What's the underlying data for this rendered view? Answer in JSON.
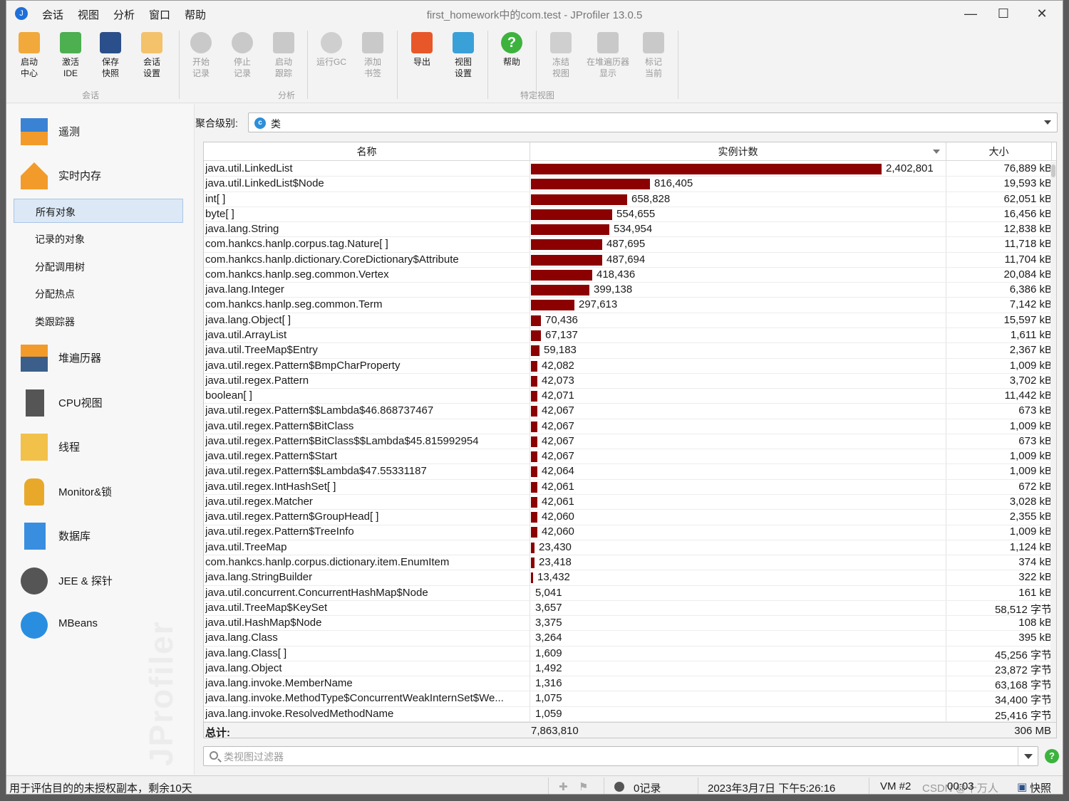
{
  "menu": {
    "items": [
      "会话",
      "视图",
      "分析",
      "窗口",
      "帮助"
    ]
  },
  "window": {
    "title": "first_homework中的com.test - JProfiler 13.0.5",
    "minimize": "—",
    "maximize": "☐",
    "close": "✕"
  },
  "toolbar": {
    "buttons": [
      {
        "label": "启动\n中心",
        "icon": "start-center-icon",
        "enabled": true
      },
      {
        "label": "激活\nIDE",
        "icon": "activate-ide-icon",
        "enabled": true
      },
      {
        "label": "保存\n快照",
        "icon": "save-snapshot-icon",
        "enabled": true
      },
      {
        "label": "会话\n设置",
        "icon": "session-settings-icon",
        "enabled": true
      },
      {
        "label": "开始\n记录",
        "icon": "start-recording-icon",
        "enabled": false
      },
      {
        "label": "停止\n记录",
        "icon": "stop-recording-icon",
        "enabled": false
      },
      {
        "label": "启动\n跟踪",
        "icon": "start-tracking-icon",
        "enabled": false
      },
      {
        "label": "运行GC",
        "icon": "run-gc-icon",
        "enabled": false
      },
      {
        "label": "添加\n书签",
        "icon": "add-bookmark-icon",
        "enabled": false
      },
      {
        "label": "导出",
        "icon": "export-icon",
        "enabled": true
      },
      {
        "label": "视图\n设置",
        "icon": "view-settings-icon",
        "enabled": true
      },
      {
        "label": "帮助",
        "icon": "help-icon",
        "enabled": true
      },
      {
        "label": "冻结\n视图",
        "icon": "freeze-view-icon",
        "enabled": false
      },
      {
        "label": "在堆遍历器\n显示",
        "icon": "show-in-heap-walker-icon",
        "enabled": false
      },
      {
        "label": "标记\n当前",
        "icon": "mark-current-icon",
        "enabled": false
      }
    ],
    "groups": [
      "会话",
      "分析",
      "特定视图"
    ]
  },
  "sidebar": {
    "sections": [
      {
        "label": "遥测",
        "icon": "telemetry-icon"
      },
      {
        "label": "实时内存",
        "icon": "live-memory-icon"
      },
      {
        "label": "堆遍历器",
        "icon": "heap-walker-icon"
      },
      {
        "label": "CPU视图",
        "icon": "cpu-views-icon"
      },
      {
        "label": "线程",
        "icon": "threads-icon"
      },
      {
        "label": "Monitor&锁",
        "icon": "monitors-locks-icon"
      },
      {
        "label": "数据库",
        "icon": "databases-icon"
      },
      {
        "label": "JEE & 探针",
        "icon": "jee-probes-icon"
      },
      {
        "label": "MBeans",
        "icon": "mbeans-icon"
      }
    ],
    "live_memory_items": [
      "所有对象",
      "记录的对象",
      "分配调用树",
      "分配热点",
      "类跟踪器"
    ],
    "selected": "所有对象",
    "watermark": "JProfiler"
  },
  "main": {
    "aggregation_label": "聚合级别:",
    "aggregation_value": "类",
    "aggregation_icon_letter": "c",
    "columns": [
      "名称",
      "实例计数",
      "大小"
    ],
    "total_label": "总计:",
    "total_count": "7,863,810",
    "total_size": "306 MB",
    "filter_placeholder": "类视图过滤器",
    "bar_color": "#8b0000"
  },
  "rows": [
    {
      "name": "java.util.LinkedList",
      "count": 2402801,
      "count_label": "2,402,801",
      "size": "76,889 kB"
    },
    {
      "name": "java.util.LinkedList$Node",
      "count": 816405,
      "count_label": "816,405",
      "size": "19,593 kB"
    },
    {
      "name": "int[ ]",
      "count": 658828,
      "count_label": "658,828",
      "size": "62,051 kB"
    },
    {
      "name": "byte[ ]",
      "count": 554655,
      "count_label": "554,655",
      "size": "16,456 kB"
    },
    {
      "name": "java.lang.String",
      "count": 534954,
      "count_label": "534,954",
      "size": "12,838 kB"
    },
    {
      "name": "com.hankcs.hanlp.corpus.tag.Nature[ ]",
      "count": 487695,
      "count_label": "487,695",
      "size": "11,718 kB"
    },
    {
      "name": "com.hankcs.hanlp.dictionary.CoreDictionary$Attribute",
      "count": 487694,
      "count_label": "487,694",
      "size": "11,704 kB"
    },
    {
      "name": "com.hankcs.hanlp.seg.common.Vertex",
      "count": 418436,
      "count_label": "418,436",
      "size": "20,084 kB"
    },
    {
      "name": "java.lang.Integer",
      "count": 399138,
      "count_label": "399,138",
      "size": "6,386 kB"
    },
    {
      "name": "com.hankcs.hanlp.seg.common.Term",
      "count": 297613,
      "count_label": "297,613",
      "size": "7,142 kB"
    },
    {
      "name": "java.lang.Object[ ]",
      "count": 70436,
      "count_label": "70,436",
      "size": "15,597 kB"
    },
    {
      "name": "java.util.ArrayList",
      "count": 67137,
      "count_label": "67,137",
      "size": "1,611 kB"
    },
    {
      "name": "java.util.TreeMap$Entry",
      "count": 59183,
      "count_label": "59,183",
      "size": "2,367 kB"
    },
    {
      "name": "java.util.regex.Pattern$BmpCharProperty",
      "count": 42082,
      "count_label": "42,082",
      "size": "1,009 kB"
    },
    {
      "name": "java.util.regex.Pattern",
      "count": 42073,
      "count_label": "42,073",
      "size": "3,702 kB"
    },
    {
      "name": "boolean[ ]",
      "count": 42071,
      "count_label": "42,071",
      "size": "11,442 kB"
    },
    {
      "name": "java.util.regex.Pattern$$Lambda$46.868737467",
      "count": 42067,
      "count_label": "42,067",
      "size": "673 kB"
    },
    {
      "name": "java.util.regex.Pattern$BitClass",
      "count": 42067,
      "count_label": "42,067",
      "size": "1,009 kB"
    },
    {
      "name": "java.util.regex.Pattern$BitClass$$Lambda$45.815992954",
      "count": 42067,
      "count_label": "42,067",
      "size": "673 kB"
    },
    {
      "name": "java.util.regex.Pattern$Start",
      "count": 42067,
      "count_label": "42,067",
      "size": "1,009 kB"
    },
    {
      "name": "java.util.regex.Pattern$$Lambda$47.55331187",
      "count": 42064,
      "count_label": "42,064",
      "size": "1,009 kB"
    },
    {
      "name": "java.util.regex.IntHashSet[ ]",
      "count": 42061,
      "count_label": "42,061",
      "size": "672 kB"
    },
    {
      "name": "java.util.regex.Matcher",
      "count": 42061,
      "count_label": "42,061",
      "size": "3,028 kB"
    },
    {
      "name": "java.util.regex.Pattern$GroupHead[ ]",
      "count": 42060,
      "count_label": "42,060",
      "size": "2,355 kB"
    },
    {
      "name": "java.util.regex.Pattern$TreeInfo",
      "count": 42060,
      "count_label": "42,060",
      "size": "1,009 kB"
    },
    {
      "name": "java.util.TreeMap",
      "count": 23430,
      "count_label": "23,430",
      "size": "1,124 kB"
    },
    {
      "name": "com.hankcs.hanlp.corpus.dictionary.item.EnumItem",
      "count": 23418,
      "count_label": "23,418",
      "size": "374 kB"
    },
    {
      "name": "java.lang.StringBuilder",
      "count": 13432,
      "count_label": "13,432",
      "size": "322 kB"
    },
    {
      "name": "java.util.concurrent.ConcurrentHashMap$Node",
      "count": 5041,
      "count_label": "5,041",
      "size": "161 kB"
    },
    {
      "name": "java.util.TreeMap$KeySet",
      "count": 3657,
      "count_label": "3,657",
      "size": "58,512 字节"
    },
    {
      "name": "java.util.HashMap$Node",
      "count": 3375,
      "count_label": "3,375",
      "size": "108 kB"
    },
    {
      "name": "java.lang.Class",
      "count": 3264,
      "count_label": "3,264",
      "size": "395 kB"
    },
    {
      "name": "java.lang.Class[ ]",
      "count": 1609,
      "count_label": "1,609",
      "size": "45,256 字节"
    },
    {
      "name": "java.lang.Object",
      "count": 1492,
      "count_label": "1,492",
      "size": "23,872 字节"
    },
    {
      "name": "java.lang.invoke.MemberName",
      "count": 1316,
      "count_label": "1,316",
      "size": "63,168 字节"
    },
    {
      "name": "java.lang.invoke.MethodType$ConcurrentWeakInternSet$We...",
      "count": 1075,
      "count_label": "1,075",
      "size": "34,400 字节"
    },
    {
      "name": "java.lang.invoke.ResolvedMethodName",
      "count": 1059,
      "count_label": "1,059",
      "size": "25,416 字节"
    }
  ],
  "status": {
    "license": "用于评估目的的未授权副本，剩余10天",
    "recordings": "0记录",
    "datetime": "2023年3月7日 下午5:26:16",
    "vm": "VM #2",
    "elapsed": "00:03",
    "mode": "快照",
    "overlay": "CSDN @十万人"
  }
}
